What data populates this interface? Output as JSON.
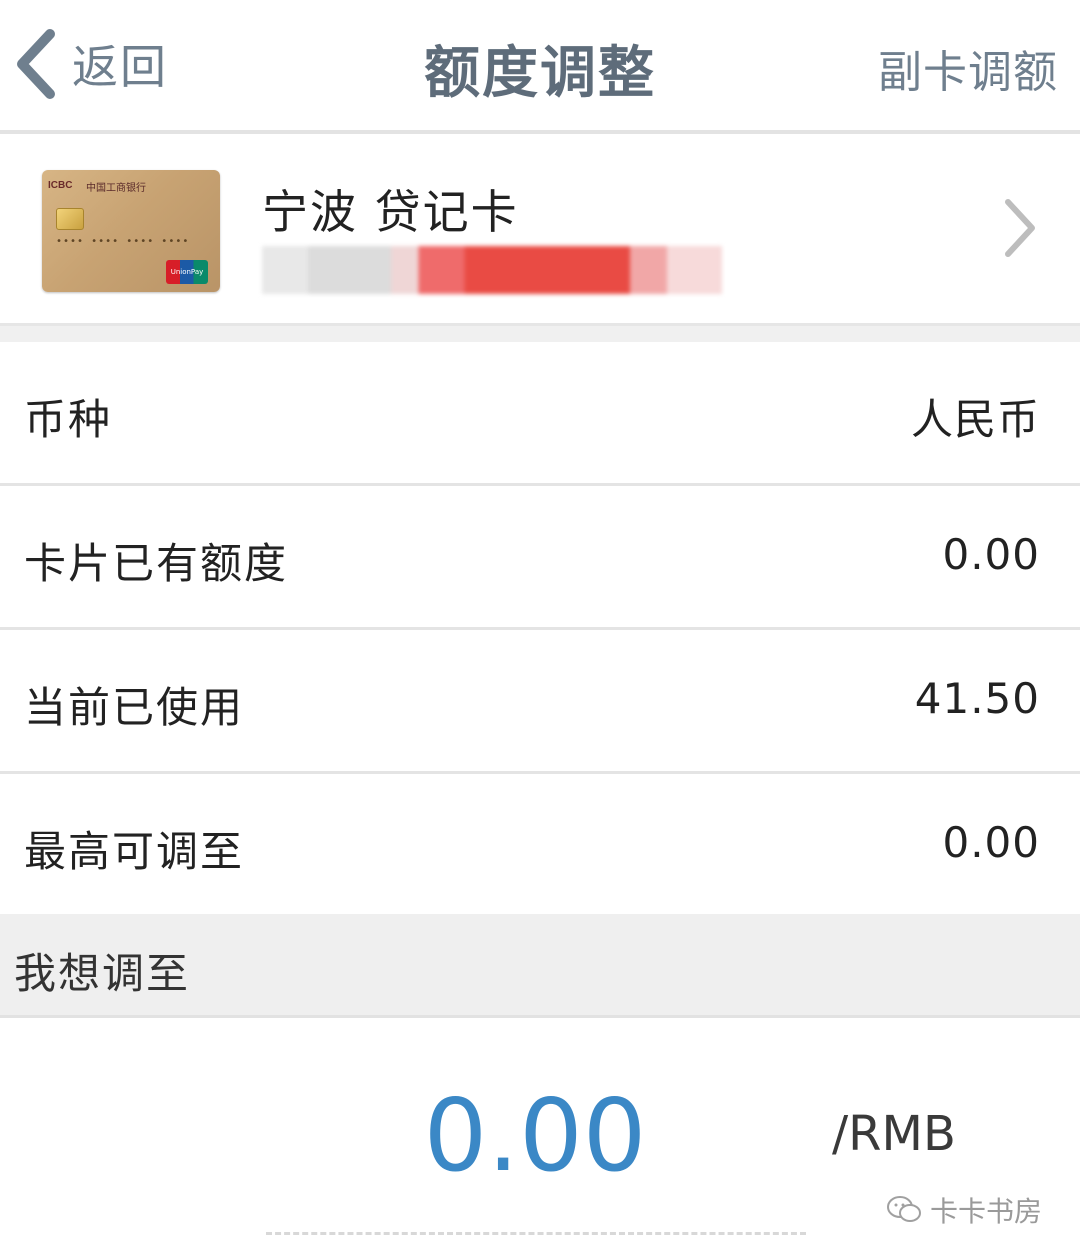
{
  "header": {
    "back_label": "返回",
    "title": "额度调整",
    "right_action": "副卡调额"
  },
  "card": {
    "name": "宁波 贷记卡",
    "image": {
      "bank_logo": "ICBC",
      "bank_name": "中国工商银行",
      "network": "UnionPay"
    }
  },
  "rows": [
    {
      "label": "币种",
      "value": "人民币"
    },
    {
      "label": "卡片已有额度",
      "value": "0.00"
    },
    {
      "label": "当前已使用",
      "value": "41.50"
    },
    {
      "label": "最高可调至",
      "value": "0.00"
    }
  ],
  "section": {
    "title": "我想调至"
  },
  "amount": {
    "value": "0.00",
    "unit": "/RMB"
  },
  "watermark": {
    "text": "卡卡书房"
  },
  "colors": {
    "amount": "#3b88c6",
    "header_text": "#6f7f8e"
  }
}
